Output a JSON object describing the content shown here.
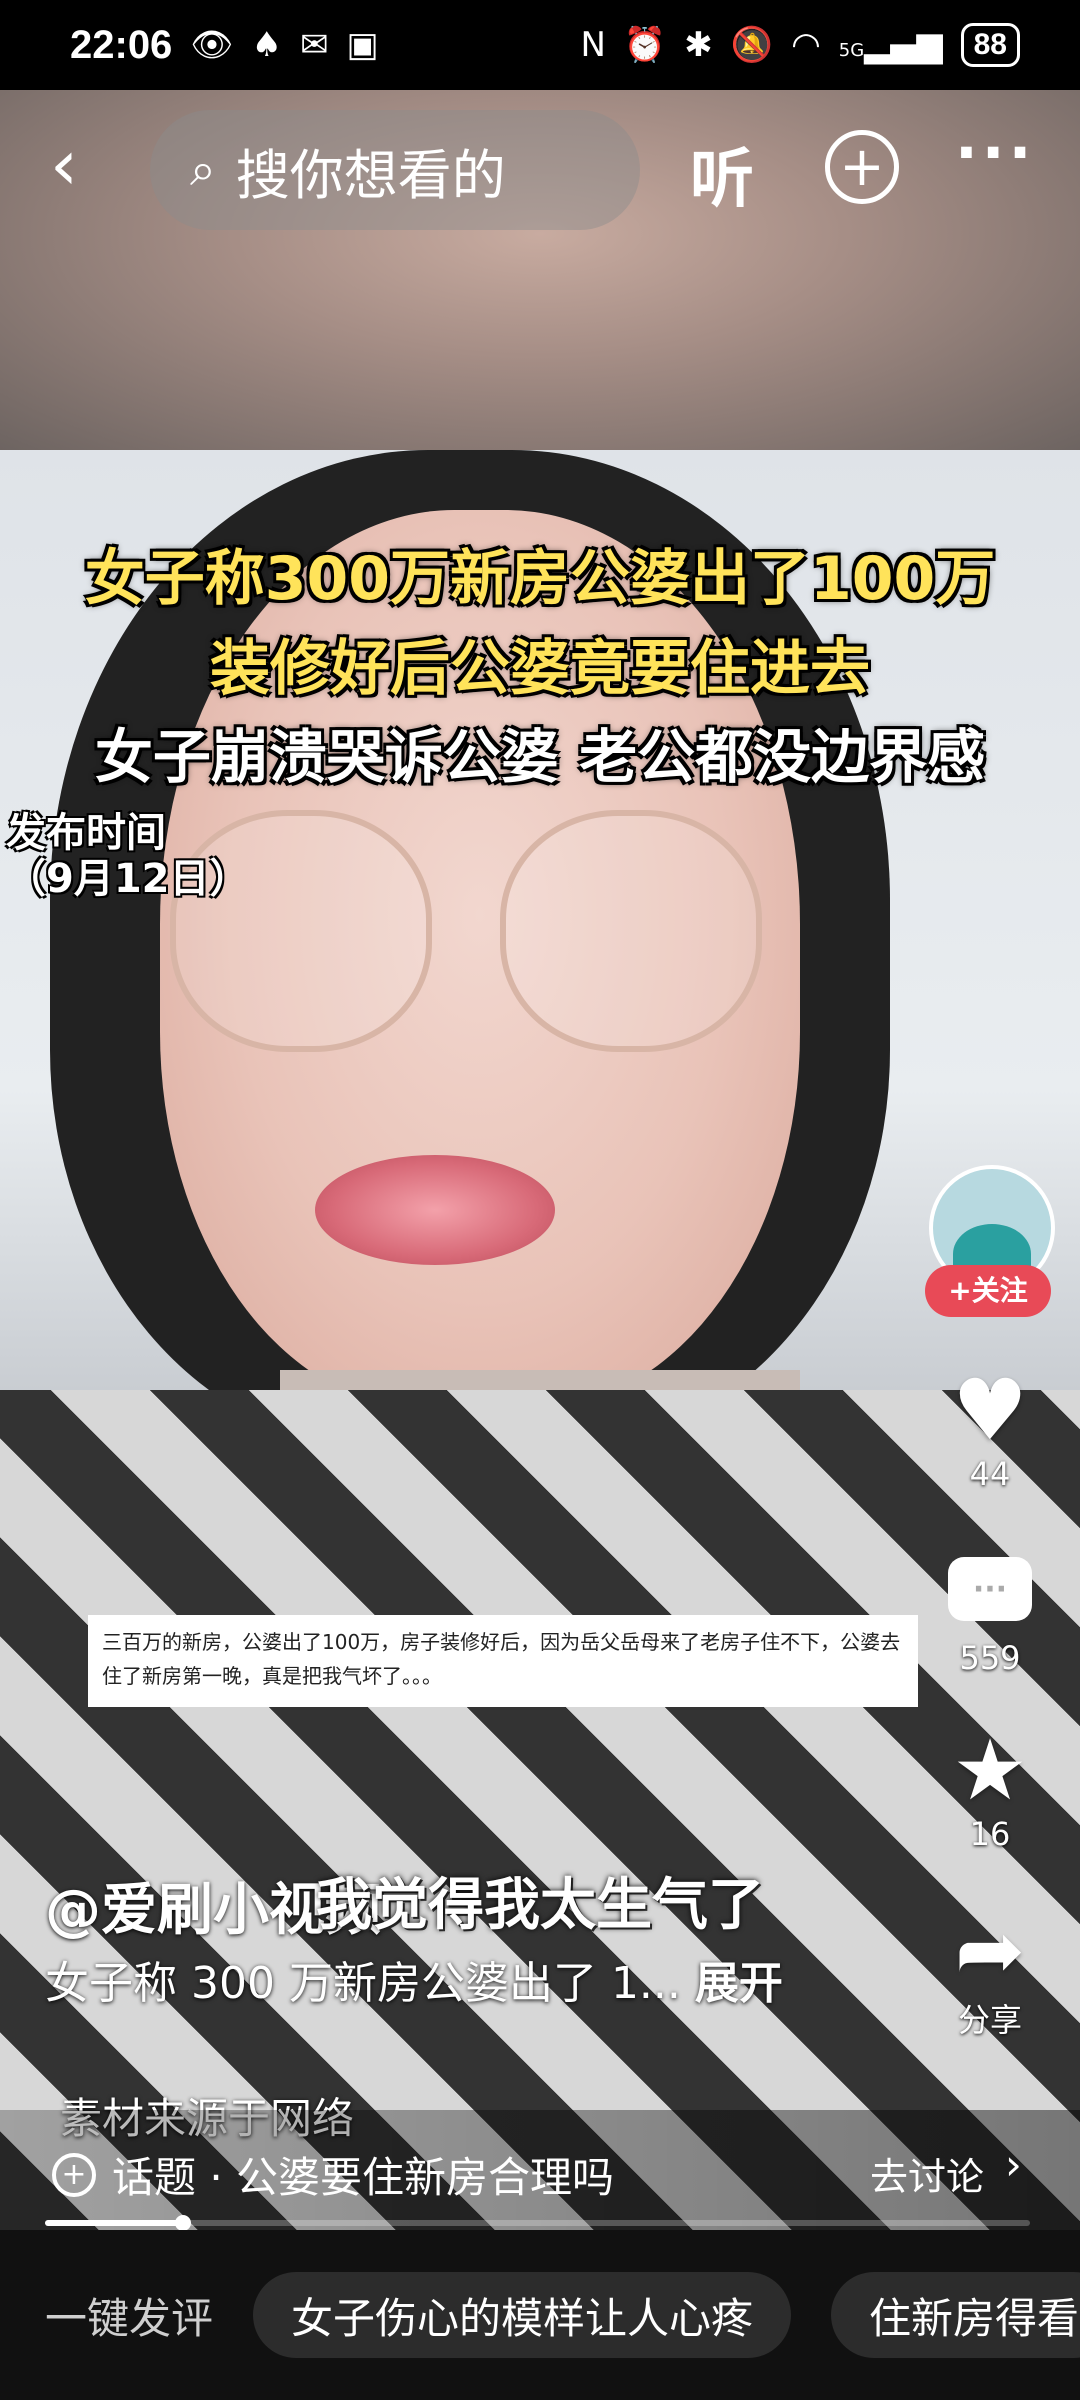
{
  "status": {
    "time": "22:06",
    "battery": "88",
    "signal_label": "5G",
    "icons": [
      "eye-icon",
      "qq-icon",
      "wechat-icon",
      "app-icon",
      "nfc-icon",
      "alarm-icon",
      "bluetooth-icon",
      "mute-icon",
      "wifi-icon",
      "signal-icon",
      "battery-icon"
    ]
  },
  "topbar": {
    "search_placeholder": "搜你想看的",
    "listen_label": "听",
    "add_icon": "plus-circle-icon",
    "more_label": "···"
  },
  "video": {
    "headline_line1": "女子称300万新房公婆出了100万",
    "headline_line2": "装修好后公婆竟要住进去",
    "headline_line3": "女子崩溃哭诉公婆 老公都没边界感",
    "publish_label": "发布时间",
    "publish_date": "（9月12日）",
    "caption_box": "三百万的新房，公婆出了100万，房子装修好后，因为岳父岳母来了老房子住不下，公婆去住了新房第一晚，真是把我气坏了。。。",
    "subtitle": "我觉得我太生气了"
  },
  "side": {
    "follow_label": "+关注",
    "like_count": "44",
    "comment_count": "559",
    "favorite_count": "16",
    "share_label": "分享"
  },
  "post": {
    "author": "@爱刷小视频",
    "description": "女子称 300 万新房公婆出了 1...",
    "expand_label": "展开",
    "source_note": "素材来源于网络"
  },
  "topic": {
    "label": "话题 · 公婆要住新房合理吗",
    "discuss_label": "去讨论"
  },
  "progress": {
    "fraction": 0.14
  },
  "bottom": {
    "quick_comment": "一键发评",
    "chip1": "女子伤心的模样让人心疼",
    "chip2": "住新房得看"
  },
  "colors": {
    "headline_yellow": "#ffe35a",
    "follow_red": "#e84a57",
    "background": "#000000"
  }
}
